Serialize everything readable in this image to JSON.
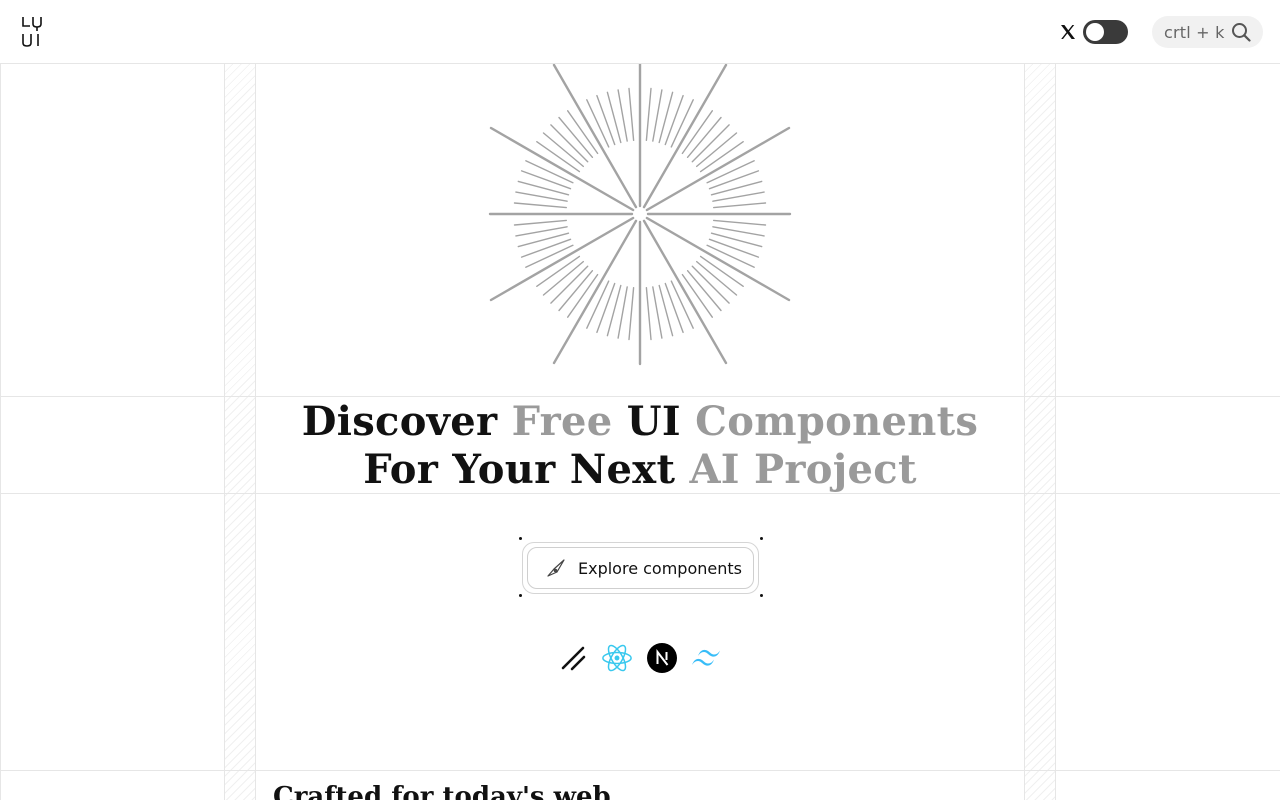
{
  "header": {
    "logo": "lyui-logo",
    "social_icon": "x-icon",
    "theme_toggle": {
      "state": "dark-off",
      "icon": "toggle-switch"
    },
    "search": {
      "shortcut": "crtl + k",
      "icon": "search-icon"
    }
  },
  "hero": {
    "graphic": "starburst",
    "headline": {
      "line1": [
        {
          "text": "Discover",
          "muted": false
        },
        {
          "text": " ",
          "muted": false
        },
        {
          "text": "Free",
          "muted": true
        },
        {
          "text": " ",
          "muted": false
        },
        {
          "text": "UI",
          "muted": false
        },
        {
          "text": " ",
          "muted": false
        },
        {
          "text": "Components",
          "muted": true
        }
      ],
      "line2": [
        {
          "text": "For Your Next",
          "muted": false
        },
        {
          "text": " ",
          "muted": false
        },
        {
          "text": "AI Project",
          "muted": true
        }
      ]
    },
    "cta": {
      "label": "Explore components",
      "icon": "compass-icon"
    },
    "tech_icons": [
      "shadcn-icon",
      "react-icon",
      "nextjs-icon",
      "tailwind-icon"
    ]
  },
  "section": {
    "title": "Crafted for today's web"
  },
  "colors": {
    "text": "#111111",
    "muted": "#9a9a9a",
    "grid": "#e6e6e6",
    "toggle": "#3a3a3a",
    "react": "#61dafb",
    "tailwind": "#38bdf8"
  }
}
